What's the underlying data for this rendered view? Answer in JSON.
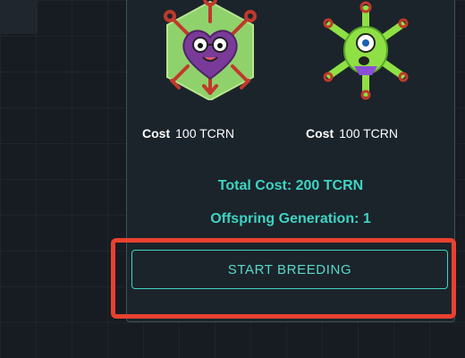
{
  "creatures": [
    {
      "name_icon": "purple-heart-creature-icon",
      "cost_label": "Cost",
      "cost_value": "100 TCRN"
    },
    {
      "name_icon": "green-cyclops-creature-icon",
      "cost_label": "Cost",
      "cost_value": "100 TCRN"
    }
  ],
  "summary": {
    "total_cost": "Total Cost: 200 TCRN",
    "offspring_generation": "Offspring Generation: 1"
  },
  "actions": {
    "start_breeding_label": "START BREEDING"
  },
  "colors": {
    "accent": "#3fd3c2",
    "highlight": "#e8412f",
    "panel": "#1b242b",
    "background": "#161c22"
  }
}
